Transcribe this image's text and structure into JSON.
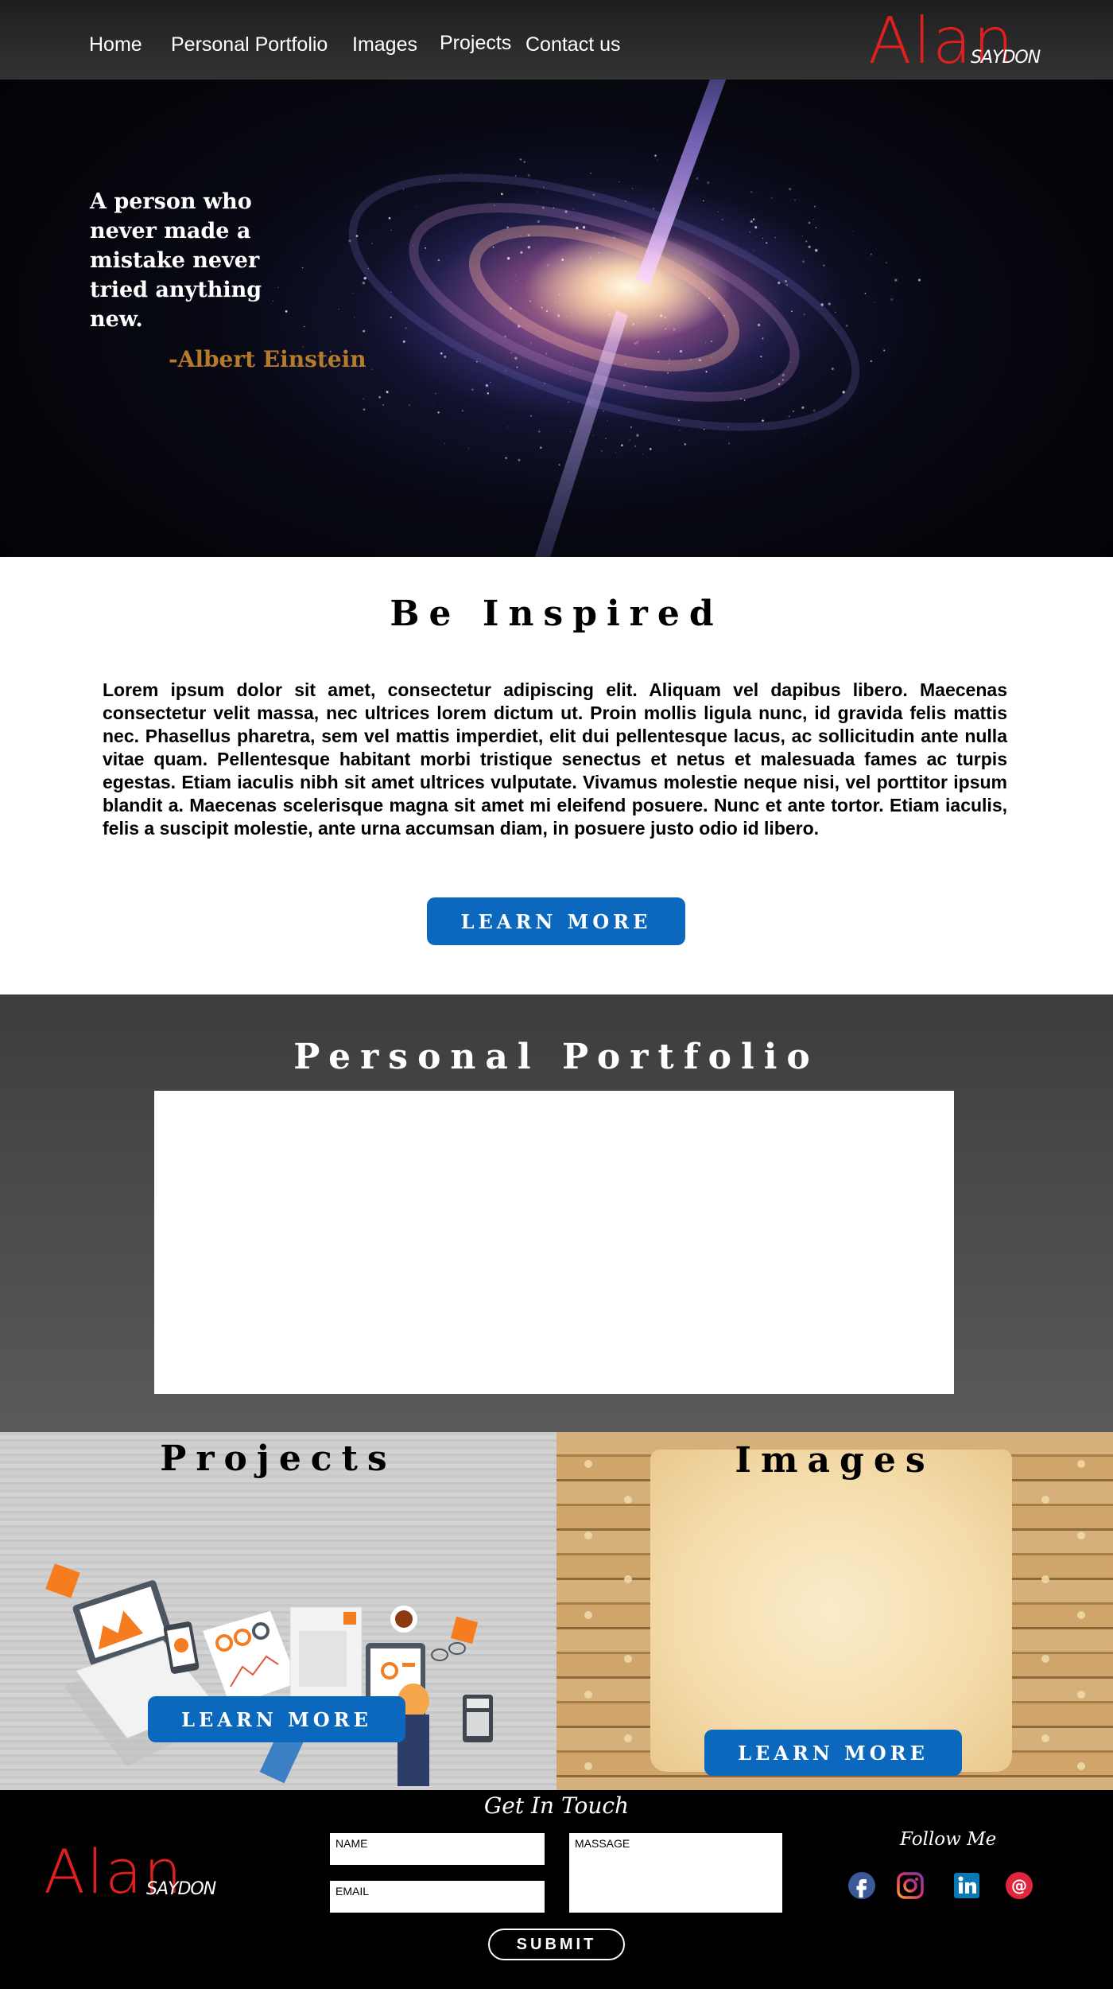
{
  "nav": {
    "items": [
      "Home",
      "Personal Portfolio",
      "Images",
      "Projects",
      "Contact us"
    ],
    "logo_main": "Alan",
    "logo_sub": "SAYDON"
  },
  "hero": {
    "quote": "A person who never made a mistake never tried anything new.",
    "author": "-Albert Einstein"
  },
  "inspired": {
    "title": "Be Inspired",
    "body": "Lorem ipsum dolor sit amet, consectetur adipiscing elit. Aliquam vel dapibus libero. Maecenas consectetur velit massa, nec ultrices lorem dictum ut. Proin mollis ligula nunc, id gravida felis mattis nec. Phasellus pharetra, sem vel mattis imperdiet, elit dui pellentesque lacus, ac sollicitudin ante nulla vitae quam. Pellentesque habitant morbi tristique senectus et netus et malesuada fames ac turpis egestas. Etiam iaculis nibh sit amet ultrices vulputate. Vivamus molestie neque nisi, vel porttitor ipsum blandit a. Maecenas scelerisque magna sit amet mi eleifend posuere. Nunc et ante tortor. Etiam iaculis, felis a suscipit molestie, ante urna accumsan diam, in posuere justo odio id libero.",
    "button": "LEARN MORE"
  },
  "portfolio": {
    "title": "Personal Portfolio"
  },
  "projects": {
    "title": "Projects",
    "button": "LEARN MORE"
  },
  "images": {
    "title": "Images",
    "button": "LEARN MORE"
  },
  "footer": {
    "heading": "Get In Touch",
    "logo_main": "Alan",
    "logo_sub": "SAYDON",
    "name_label": "NAME",
    "email_label": "EMAIL",
    "message_label": "MASSAGE",
    "submit": "SUBMIT",
    "follow": "Follow Me",
    "social": [
      "facebook-icon",
      "instagram-icon",
      "linkedin-icon",
      "email-icon"
    ]
  },
  "colors": {
    "logo_red": "#e0201e",
    "button_blue": "#0b68bd",
    "author_gold": "#b57a2a"
  }
}
